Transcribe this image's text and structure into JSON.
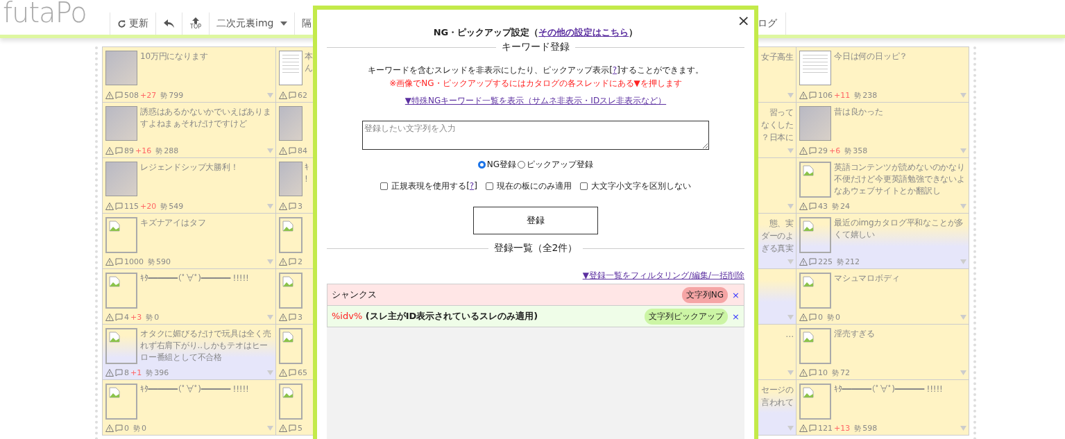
{
  "header": {
    "logo": "futaPo",
    "toolbar": [
      {
        "kind": "refresh",
        "label": "更新"
      },
      {
        "kind": "back"
      },
      {
        "kind": "top",
        "label": "TOP"
      },
      {
        "kind": "board",
        "label": "二次元裏img"
      },
      {
        "kind": "text",
        "label": "隔"
      }
    ],
    "toolbar_right": [
      {
        "label": "ログ"
      }
    ]
  },
  "catalog": {
    "columns": [
      {
        "kind": "full",
        "cells": [
          {
            "kind": "photo",
            "title": "10万円になります",
            "replies": "508",
            "new": "+27",
            "mark": "勢",
            "momentum": "799",
            "highlighted": false
          },
          {
            "kind": "photo",
            "title": "誘惑はあるかないかでいえばありますよねまぁそれだけですけど",
            "replies": "89",
            "new": "+16",
            "mark": "勢",
            "momentum": "288",
            "highlighted": false
          },
          {
            "kind": "photo",
            "title": "レジェンドシップ大勝利！",
            "replies": "115",
            "new": "+20",
            "mark": "勢",
            "momentum": "549",
            "highlighted": false
          },
          {
            "kind": "broken",
            "title": "キズナアイはタフ",
            "replies": "1000",
            "mark": "勢",
            "momentum": "590",
            "highlighted": false
          },
          {
            "kind": "broken",
            "title": "ｷﾀ━━━━━━(ﾟ∀ﾟ)━━━━━━ !!!!!",
            "replies": "4",
            "new": "+3",
            "mark": "勢",
            "momentum": "0",
            "highlighted": false
          },
          {
            "kind": "broken",
            "title": "オタクに媚びるだけで玩具は全く売れず右肩下がり..しかもテオはヒーロー番組として不合格",
            "replies": "8",
            "new": "+1",
            "mark": "勢",
            "momentum": "396",
            "highlighted": true
          },
          {
            "kind": "broken",
            "title": "ｷﾀ━━━━━━(ﾟ∀ﾟ)━━━━━━ !!!!!",
            "replies": "0",
            "mark": "勢",
            "momentum": "0",
            "highlighted": false
          }
        ]
      },
      {
        "kind": "left_edge",
        "cells": [
          {
            "kind": "document",
            "lines": [
              "本",
              "ん"
            ],
            "replies": "62",
            "highlighted": false
          },
          {
            "kind": "photo",
            "replies": "84",
            "highlighted": false
          },
          {
            "kind": "photo",
            "lines": [
              "ｷ",
              "!"
            ],
            "replies": "3",
            "highlighted": false
          },
          {
            "kind": "broken",
            "replies": "2",
            "highlighted": false
          },
          {
            "kind": "broken",
            "replies": "3",
            "highlighted": false
          },
          {
            "kind": "broken",
            "replies": "65",
            "highlighted": false
          },
          {
            "kind": "broken",
            "replies": "5",
            "highlighted": false
          }
        ]
      },
      {
        "kind": "right_edge",
        "cells": [
          {
            "lines": [
              "女子高生"
            ],
            "highlighted": false
          },
          {
            "lines": [
              "習って",
              "なくした",
              "？日本に"
            ],
            "highlighted": false
          },
          {
            "highlighted": false
          },
          {
            "lines": [
              "態、実",
              "ダーのよ",
              "ぎる真実"
            ],
            "highlighted": true
          },
          {
            "highlighted": true
          },
          {
            "lines": [
              "…"
            ],
            "highlighted": false
          },
          {
            "lines": [
              "セージの",
              "言われて"
            ],
            "highlighted": true
          }
        ]
      },
      {
        "kind": "full",
        "cells": [
          {
            "kind": "document",
            "title": "今日は何の日ッピ？",
            "replies": "106",
            "new": "+11",
            "mark": "勢",
            "momentum": "238",
            "highlighted": false
          },
          {
            "kind": "photo",
            "title": "昔は良かった",
            "replies": "29",
            "new": "+6",
            "mark": "勢",
            "momentum": "358",
            "highlighted": false
          },
          {
            "kind": "broken",
            "title": "英語コンテンツが読めないのかなり不便だけど今更英語勉強できないよなあウェブサイトとか翻訳し",
            "replies": "43",
            "mark": "勢",
            "momentum": "24",
            "highlighted": false
          },
          {
            "kind": "broken",
            "title": "最近のimgカタログ平和なことが多くて嬉しい",
            "replies": "225",
            "mark": "勢",
            "momentum": "212",
            "highlighted": true
          },
          {
            "kind": "broken",
            "title": "マシュマロボディ",
            "replies": "0",
            "mark": "勢",
            "momentum": "0",
            "highlighted": false
          },
          {
            "kind": "broken",
            "title": "淫売すぎる",
            "replies": "10",
            "mark": "勢",
            "momentum": "72",
            "highlighted": false
          },
          {
            "kind": "broken",
            "title": "ｷﾀ━━━━━━(ﾟ∀ﾟ)━━━━━━ !!!!!",
            "replies": "121",
            "new": "+13",
            "mark": "勢",
            "momentum": "598",
            "highlighted": false
          }
        ]
      }
    ]
  },
  "dialog": {
    "title": {
      "text": "NG・ピックアップ設定（",
      "link": "その他の設定はこちら",
      "suffix": "）"
    },
    "keyword_section": "キーワード登録",
    "description": {
      "text": "キーワードを含むスレッドを非表示にしたり、ピックアップ表示[",
      "link": "?",
      "suffix": "]することができます。"
    },
    "note": "※画像でNG・ピックアップするにはカタログの各スレッドにある▼を押します",
    "special_link": "▼特殊NGキーワード一覧を表示（サムネ非表示・IDスレ非表示など）",
    "input": {
      "placeholder": "登録したい文字列を入力"
    },
    "modes": [
      {
        "label": "NG登録",
        "selected": true
      },
      {
        "label": "ピックアップ登録",
        "selected": false
      }
    ],
    "options": [
      {
        "label": "正規表現を使用する[",
        "link": "?",
        "suffix": "]",
        "checked": false
      },
      {
        "label": "現在の板にのみ適用",
        "checked": false
      },
      {
        "label": "大文字小文字を区別しない",
        "checked": false
      }
    ],
    "submit": "登録",
    "list_section": "登録一覧（全2件）",
    "list_link": "▼登録一覧をフィルタリング/編集/一括削除",
    "entries": [
      {
        "kind": "ng",
        "keyword": "シャンクス",
        "tag": "文字列NG",
        "remove": "×"
      },
      {
        "kind": "pickup",
        "keyword": "%idv%",
        "note": " (スレ主がID表示されているスレのみ適用)",
        "tag": "文字列ピックアップ",
        "remove": "×"
      }
    ],
    "close": "×"
  }
}
